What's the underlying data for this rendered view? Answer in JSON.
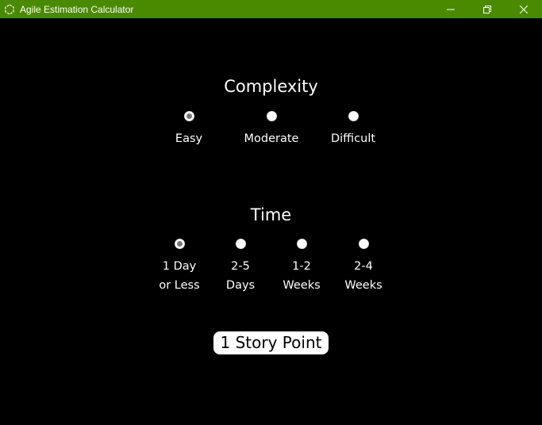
{
  "window": {
    "title": "Agile Estimation Calculator",
    "icons": [
      "app-icon",
      "minimize-icon",
      "restore-icon",
      "close-icon"
    ],
    "titlebar_color": "#4a8a00"
  },
  "complexity": {
    "title": "Complexity",
    "options": [
      {
        "label": "Easy",
        "checked": true
      },
      {
        "label": "Moderate",
        "checked": false
      },
      {
        "label": "Difficult",
        "checked": false
      }
    ]
  },
  "time": {
    "title": "Time",
    "options": [
      {
        "line1": "1 Day",
        "line2": "or Less",
        "checked": true
      },
      {
        "line1": "2-5",
        "line2": "Days",
        "checked": false
      },
      {
        "line1": "1-2",
        "line2": "Weeks",
        "checked": false
      },
      {
        "line1": "2-4",
        "line2": "Weeks",
        "checked": false
      }
    ]
  },
  "result": {
    "text": "1 Story Point"
  },
  "colors": {
    "background": "#000000",
    "text": "#ffffff",
    "radio_checked_dot": "#777777"
  }
}
